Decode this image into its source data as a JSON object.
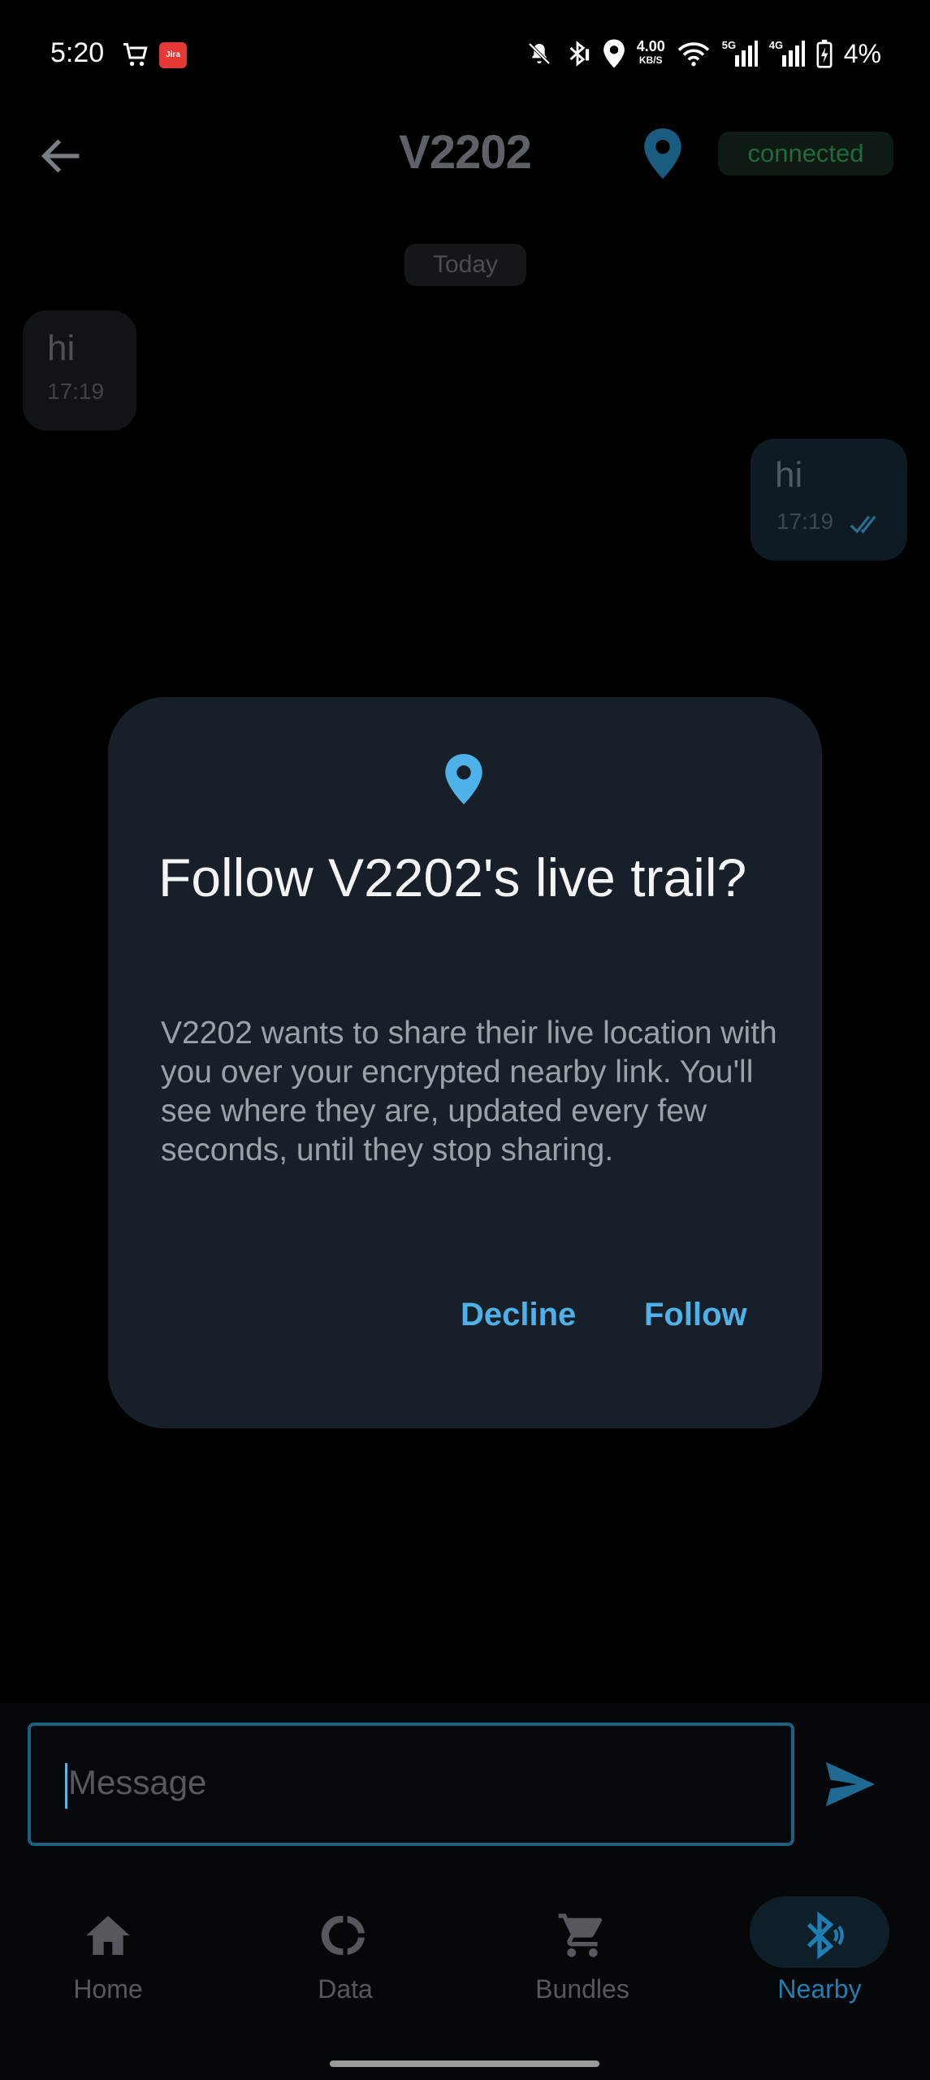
{
  "status_bar": {
    "time": "5:20",
    "app_badge": "Jira",
    "speed_value": "4.00",
    "speed_unit": "KB/S",
    "net_5g": "5G",
    "net_4g": "4G",
    "battery": "4%"
  },
  "header": {
    "title": "V2202",
    "connection_status": "connected"
  },
  "messages": {
    "date_divider": "Today",
    "items": [
      {
        "direction": "incoming",
        "text": "hi",
        "time": "17:19"
      },
      {
        "direction": "outgoing",
        "text": "hi",
        "time": "17:19",
        "status": "read"
      }
    ]
  },
  "dialog": {
    "icon": "location-pin-icon",
    "title": "Follow V2202's live trail?",
    "body": "V2202 wants to share their live location with you over your encrypted nearby link. You'll see where they are, updated every few seconds, until they stop sharing.",
    "decline_label": "Decline",
    "follow_label": "Follow"
  },
  "composer": {
    "placeholder": "Message"
  },
  "bottom_nav": {
    "items": [
      {
        "label": "Home",
        "icon": "home-icon"
      },
      {
        "label": "Data",
        "icon": "data-ring-icon"
      },
      {
        "label": "Bundles",
        "icon": "cart-icon"
      },
      {
        "label": "Nearby",
        "icon": "bluetooth-icon",
        "active": true
      }
    ]
  },
  "colors": {
    "accent": "#4fb1ea",
    "dialog_bg": "#172028",
    "connected": "#1f6b39"
  }
}
